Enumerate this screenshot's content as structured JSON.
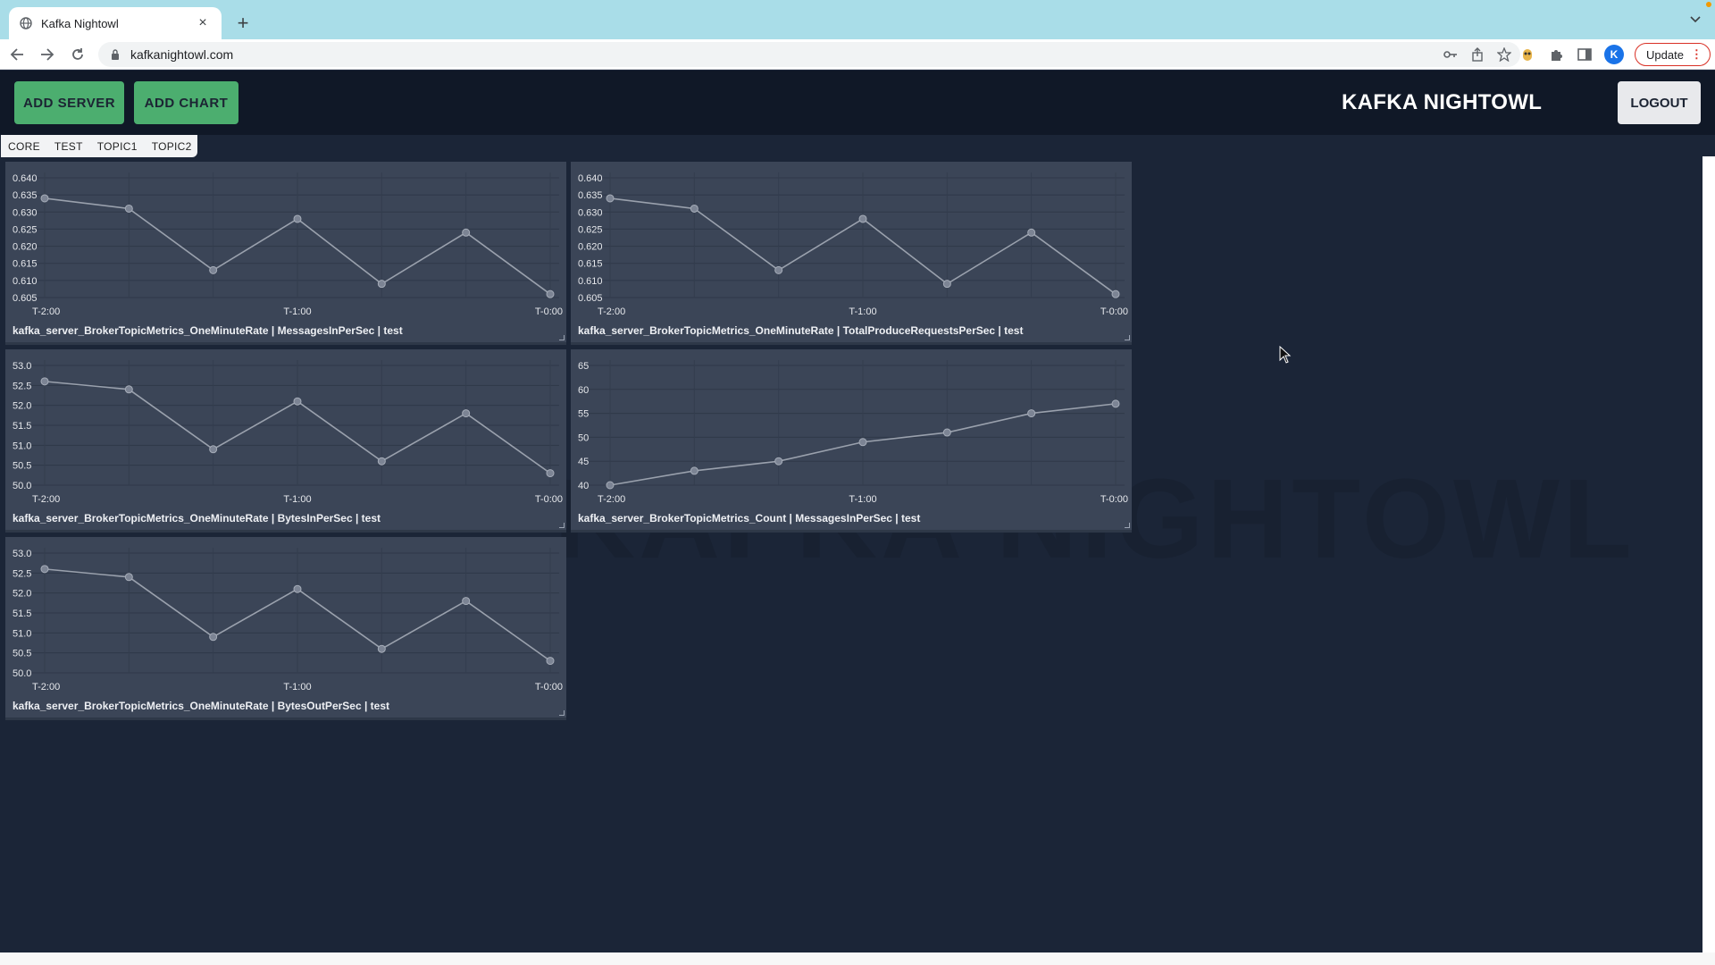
{
  "browser": {
    "tab_title": "Kafka Nightowl",
    "url": "kafkanightowl.com",
    "profile_initial": "K",
    "update_label": "Update"
  },
  "header": {
    "add_server_label": "ADD SERVER",
    "add_chart_label": "ADD CHART",
    "brand": "KAFKA NIGHTOWL",
    "logout_label": "LOGOUT"
  },
  "tabs": [
    "CORE",
    "TEST",
    "TOPIC1",
    "TOPIC2"
  ],
  "watermark": "KAFKA NIGHTOWL",
  "colors": {
    "accent_green": "#4cae6f",
    "panel_bg": "#3b4557",
    "page_bg": "#1b2537",
    "line": "#9aa1ad"
  },
  "chart_data": [
    {
      "type": "line",
      "title": "kafka_server_BrokerTopicMetrics_OneMinuteRate | MessagesInPerSec | test",
      "x_ticks": [
        "T-2:00",
        "T-1:00",
        "T-0:00"
      ],
      "y_ticks": [
        "0.640",
        "0.635",
        "0.630",
        "0.625",
        "0.620",
        "0.615",
        "0.610",
        "0.605"
      ],
      "ylim": [
        0.605,
        0.64
      ],
      "values": [
        0.634,
        0.631,
        0.613,
        0.628,
        0.609,
        0.624,
        0.606
      ],
      "grid": true
    },
    {
      "type": "line",
      "title": "kafka_server_BrokerTopicMetrics_OneMinuteRate | TotalProduceRequestsPerSec | test",
      "x_ticks": [
        "T-2:00",
        "T-1:00",
        "T-0:00"
      ],
      "y_ticks": [
        "0.640",
        "0.635",
        "0.630",
        "0.625",
        "0.620",
        "0.615",
        "0.610",
        "0.605"
      ],
      "ylim": [
        0.605,
        0.64
      ],
      "values": [
        0.634,
        0.631,
        0.613,
        0.628,
        0.609,
        0.624,
        0.606
      ],
      "grid": true
    },
    {
      "type": "line",
      "title": "kafka_server_BrokerTopicMetrics_OneMinuteRate | BytesInPerSec | test",
      "x_ticks": [
        "T-2:00",
        "T-1:00",
        "T-0:00"
      ],
      "y_ticks": [
        "53.0",
        "52.5",
        "52.0",
        "51.5",
        "51.0",
        "50.5",
        "50.0"
      ],
      "ylim": [
        50.0,
        53.0
      ],
      "values": [
        52.6,
        52.4,
        50.9,
        52.1,
        50.6,
        51.8,
        50.3
      ],
      "grid": true
    },
    {
      "type": "line",
      "title": "kafka_server_BrokerTopicMetrics_Count | MessagesInPerSec | test",
      "x_ticks": [
        "T-2:00",
        "T-1:00",
        "T-0:00"
      ],
      "y_ticks": [
        "65",
        "60",
        "55",
        "50",
        "45",
        "40"
      ],
      "ylim": [
        40,
        65
      ],
      "values": [
        40,
        43,
        45,
        49,
        51,
        55,
        57
      ],
      "grid": true
    },
    {
      "type": "line",
      "title": "kafka_server_BrokerTopicMetrics_OneMinuteRate | BytesOutPerSec | test",
      "x_ticks": [
        "T-2:00",
        "T-1:00",
        "T-0:00"
      ],
      "y_ticks": [
        "53.0",
        "52.5",
        "52.0",
        "51.5",
        "51.0",
        "50.5",
        "50.0"
      ],
      "ylim": [
        50.0,
        53.0
      ],
      "values": [
        52.6,
        52.4,
        50.9,
        52.1,
        50.6,
        51.8,
        50.3
      ],
      "grid": true
    }
  ]
}
